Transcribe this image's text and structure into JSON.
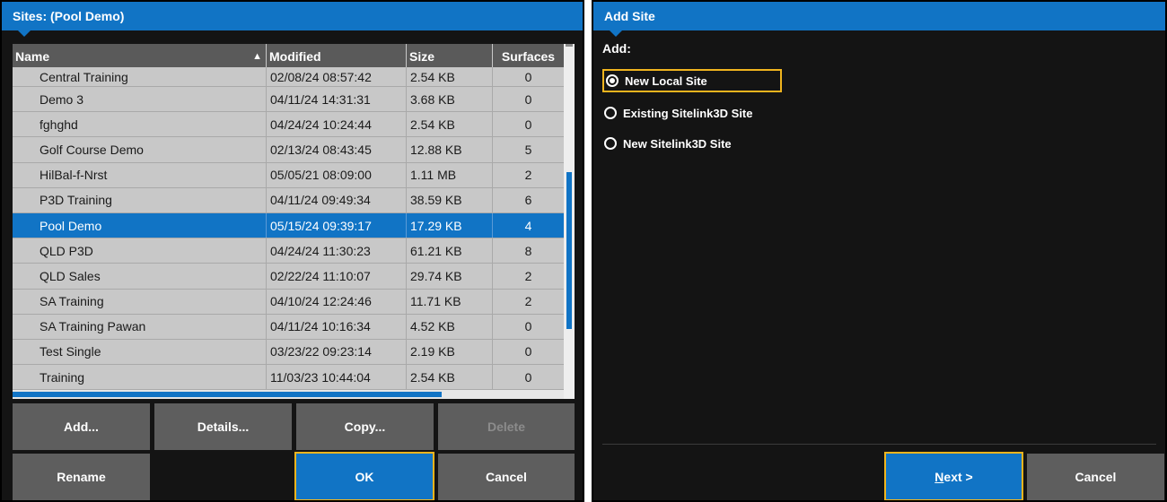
{
  "left_dialog": {
    "title": "Sites: (Pool Demo)",
    "columns": {
      "name": "Name",
      "modified": "Modified",
      "size": "Size",
      "surfaces": "Surfaces"
    },
    "rows": [
      {
        "name": "Central Training",
        "modified": "02/08/24 08:57:42",
        "size": "2.54 KB",
        "surfaces": "0"
      },
      {
        "name": "Demo 3",
        "modified": "04/11/24 14:31:31",
        "size": "3.68 KB",
        "surfaces": "0"
      },
      {
        "name": "fghghd",
        "modified": "04/24/24 10:24:44",
        "size": "2.54 KB",
        "surfaces": "0"
      },
      {
        "name": "Golf Course Demo",
        "modified": "02/13/24 08:43:45",
        "size": "12.88 KB",
        "surfaces": "5"
      },
      {
        "name": "HilBal-f-Nrst",
        "modified": "05/05/21 08:09:00",
        "size": "1.11 MB",
        "surfaces": "2"
      },
      {
        "name": "P3D Training",
        "modified": "04/11/24 09:49:34",
        "size": "38.59 KB",
        "surfaces": "6"
      },
      {
        "name": "Pool Demo",
        "modified": "05/15/24 09:39:17",
        "size": "17.29 KB",
        "surfaces": "4",
        "selected": true
      },
      {
        "name": "QLD P3D",
        "modified": "04/24/24 11:30:23",
        "size": "61.21 KB",
        "surfaces": "8"
      },
      {
        "name": "QLD Sales",
        "modified": "02/22/24 11:10:07",
        "size": "29.74 KB",
        "surfaces": "2"
      },
      {
        "name": "SA Training",
        "modified": "04/10/24 12:24:46",
        "size": "11.71 KB",
        "surfaces": "2"
      },
      {
        "name": "SA Training Pawan",
        "modified": "04/11/24 10:16:34",
        "size": "4.52 KB",
        "surfaces": "0"
      },
      {
        "name": "Test Single",
        "modified": "03/23/22 09:23:14",
        "size": "2.19 KB",
        "surfaces": "0"
      },
      {
        "name": "Training",
        "modified": "11/03/23 10:44:04",
        "size": "2.54 KB",
        "surfaces": "0"
      }
    ],
    "buttons": {
      "add": "Add...",
      "details": "Details...",
      "copy": "Copy...",
      "delete": "Delete",
      "rename": "Rename",
      "ok": "OK",
      "cancel": "Cancel"
    }
  },
  "right_dialog": {
    "title": "Add Site",
    "add_label": "Add:",
    "options": [
      {
        "label": "New Local Site",
        "selected": true
      },
      {
        "label": "Existing Sitelink3D Site",
        "selected": false
      },
      {
        "label": "New Sitelink3D Site",
        "selected": false
      }
    ],
    "buttons": {
      "next_mnemonic": "N",
      "next_rest": "ext >",
      "cancel": "Cancel"
    }
  },
  "colors": {
    "accent": "#1174c5",
    "focus": "#f0b41e",
    "button": "#5e5e5e",
    "background": "#141414"
  }
}
